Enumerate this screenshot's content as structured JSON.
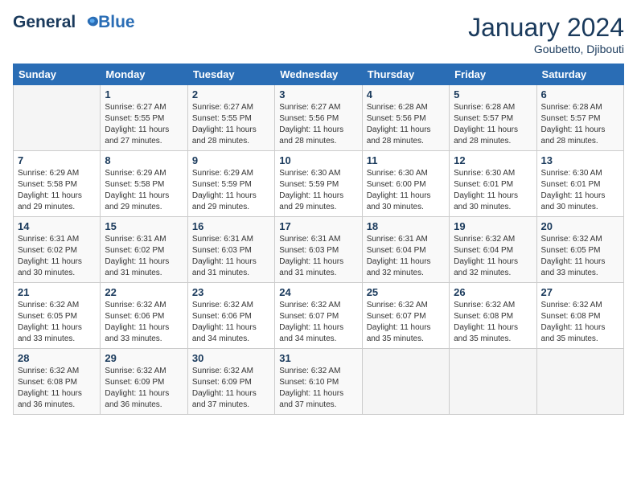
{
  "header": {
    "logo_line1": "General",
    "logo_line2": "Blue",
    "month_title": "January 2024",
    "location": "Goubetto, Djibouti"
  },
  "weekdays": [
    "Sunday",
    "Monday",
    "Tuesday",
    "Wednesday",
    "Thursday",
    "Friday",
    "Saturday"
  ],
  "weeks": [
    [
      {
        "day": "",
        "info": ""
      },
      {
        "day": "1",
        "info": "Sunrise: 6:27 AM\nSunset: 5:55 PM\nDaylight: 11 hours\nand 27 minutes."
      },
      {
        "day": "2",
        "info": "Sunrise: 6:27 AM\nSunset: 5:55 PM\nDaylight: 11 hours\nand 28 minutes."
      },
      {
        "day": "3",
        "info": "Sunrise: 6:27 AM\nSunset: 5:56 PM\nDaylight: 11 hours\nand 28 minutes."
      },
      {
        "day": "4",
        "info": "Sunrise: 6:28 AM\nSunset: 5:56 PM\nDaylight: 11 hours\nand 28 minutes."
      },
      {
        "day": "5",
        "info": "Sunrise: 6:28 AM\nSunset: 5:57 PM\nDaylight: 11 hours\nand 28 minutes."
      },
      {
        "day": "6",
        "info": "Sunrise: 6:28 AM\nSunset: 5:57 PM\nDaylight: 11 hours\nand 28 minutes."
      }
    ],
    [
      {
        "day": "7",
        "info": "Sunrise: 6:29 AM\nSunset: 5:58 PM\nDaylight: 11 hours\nand 29 minutes."
      },
      {
        "day": "8",
        "info": "Sunrise: 6:29 AM\nSunset: 5:58 PM\nDaylight: 11 hours\nand 29 minutes."
      },
      {
        "day": "9",
        "info": "Sunrise: 6:29 AM\nSunset: 5:59 PM\nDaylight: 11 hours\nand 29 minutes."
      },
      {
        "day": "10",
        "info": "Sunrise: 6:30 AM\nSunset: 5:59 PM\nDaylight: 11 hours\nand 29 minutes."
      },
      {
        "day": "11",
        "info": "Sunrise: 6:30 AM\nSunset: 6:00 PM\nDaylight: 11 hours\nand 30 minutes."
      },
      {
        "day": "12",
        "info": "Sunrise: 6:30 AM\nSunset: 6:01 PM\nDaylight: 11 hours\nand 30 minutes."
      },
      {
        "day": "13",
        "info": "Sunrise: 6:30 AM\nSunset: 6:01 PM\nDaylight: 11 hours\nand 30 minutes."
      }
    ],
    [
      {
        "day": "14",
        "info": "Sunrise: 6:31 AM\nSunset: 6:02 PM\nDaylight: 11 hours\nand 30 minutes."
      },
      {
        "day": "15",
        "info": "Sunrise: 6:31 AM\nSunset: 6:02 PM\nDaylight: 11 hours\nand 31 minutes."
      },
      {
        "day": "16",
        "info": "Sunrise: 6:31 AM\nSunset: 6:03 PM\nDaylight: 11 hours\nand 31 minutes."
      },
      {
        "day": "17",
        "info": "Sunrise: 6:31 AM\nSunset: 6:03 PM\nDaylight: 11 hours\nand 31 minutes."
      },
      {
        "day": "18",
        "info": "Sunrise: 6:31 AM\nSunset: 6:04 PM\nDaylight: 11 hours\nand 32 minutes."
      },
      {
        "day": "19",
        "info": "Sunrise: 6:32 AM\nSunset: 6:04 PM\nDaylight: 11 hours\nand 32 minutes."
      },
      {
        "day": "20",
        "info": "Sunrise: 6:32 AM\nSunset: 6:05 PM\nDaylight: 11 hours\nand 33 minutes."
      }
    ],
    [
      {
        "day": "21",
        "info": "Sunrise: 6:32 AM\nSunset: 6:05 PM\nDaylight: 11 hours\nand 33 minutes."
      },
      {
        "day": "22",
        "info": "Sunrise: 6:32 AM\nSunset: 6:06 PM\nDaylight: 11 hours\nand 33 minutes."
      },
      {
        "day": "23",
        "info": "Sunrise: 6:32 AM\nSunset: 6:06 PM\nDaylight: 11 hours\nand 34 minutes."
      },
      {
        "day": "24",
        "info": "Sunrise: 6:32 AM\nSunset: 6:07 PM\nDaylight: 11 hours\nand 34 minutes."
      },
      {
        "day": "25",
        "info": "Sunrise: 6:32 AM\nSunset: 6:07 PM\nDaylight: 11 hours\nand 35 minutes."
      },
      {
        "day": "26",
        "info": "Sunrise: 6:32 AM\nSunset: 6:08 PM\nDaylight: 11 hours\nand 35 minutes."
      },
      {
        "day": "27",
        "info": "Sunrise: 6:32 AM\nSunset: 6:08 PM\nDaylight: 11 hours\nand 35 minutes."
      }
    ],
    [
      {
        "day": "28",
        "info": "Sunrise: 6:32 AM\nSunset: 6:08 PM\nDaylight: 11 hours\nand 36 minutes."
      },
      {
        "day": "29",
        "info": "Sunrise: 6:32 AM\nSunset: 6:09 PM\nDaylight: 11 hours\nand 36 minutes."
      },
      {
        "day": "30",
        "info": "Sunrise: 6:32 AM\nSunset: 6:09 PM\nDaylight: 11 hours\nand 37 minutes."
      },
      {
        "day": "31",
        "info": "Sunrise: 6:32 AM\nSunset: 6:10 PM\nDaylight: 11 hours\nand 37 minutes."
      },
      {
        "day": "",
        "info": ""
      },
      {
        "day": "",
        "info": ""
      },
      {
        "day": "",
        "info": ""
      }
    ]
  ]
}
